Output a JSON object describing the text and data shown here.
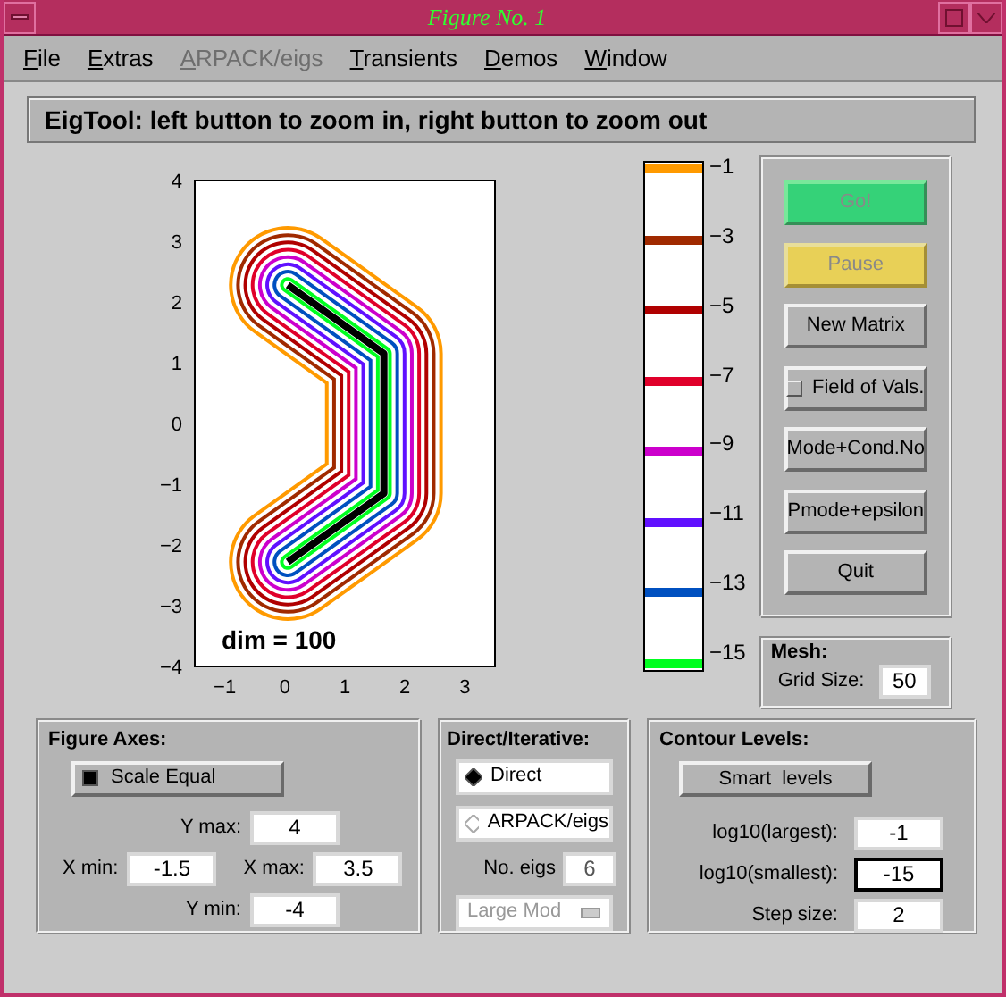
{
  "window": {
    "title": "Figure No. 1"
  },
  "menu": [
    {
      "label": "File",
      "disabled": false
    },
    {
      "label": "Extras",
      "disabled": false
    },
    {
      "label": "ARPACK/eigs",
      "disabled": true
    },
    {
      "label": "Transients",
      "disabled": false
    },
    {
      "label": "Demos",
      "disabled": false
    },
    {
      "label": "Window",
      "disabled": false
    }
  ],
  "message": "EigTool: left button to zoom in, right button to zoom out",
  "plot": {
    "yticks": [
      "4",
      "3",
      "2",
      "1",
      "0",
      "−1",
      "−2",
      "−3",
      "−4"
    ],
    "xticks": [
      "−1",
      "0",
      "1",
      "2",
      "3"
    ],
    "annotation": "dim = 100"
  },
  "colorbar": {
    "levels": [
      {
        "label": "−1",
        "color": "#ff9a00"
      },
      {
        "label": "−3",
        "color": "#a02a00"
      },
      {
        "label": "−5",
        "color": "#b00000"
      },
      {
        "label": "−7",
        "color": "#e0002a"
      },
      {
        "label": "−9",
        "color": "#cc00cc"
      },
      {
        "label": "−11",
        "color": "#6010ff"
      },
      {
        "label": "−13",
        "color": "#0050c0"
      },
      {
        "label": "−15",
        "color": "#00ff20"
      }
    ]
  },
  "buttons": [
    {
      "label": "Go!",
      "kind": "go",
      "disabled": true
    },
    {
      "label": "Pause",
      "kind": "pause",
      "disabled": true
    },
    {
      "label": "New Matrix",
      "kind": "plain",
      "disabled": false
    },
    {
      "label": "Field of Vals.",
      "kind": "toggle",
      "disabled": false,
      "checked": false
    },
    {
      "label": "Mode+Cond.No",
      "kind": "plain",
      "disabled": false
    },
    {
      "label": "Pmode+epsilon",
      "kind": "plain",
      "disabled": false
    },
    {
      "label": "Quit",
      "kind": "plain",
      "disabled": false
    }
  ],
  "mesh": {
    "title": "Mesh:",
    "label": "Grid Size:",
    "value": "50"
  },
  "figure_axes": {
    "title": "Figure Axes:",
    "scale_equal": {
      "label": "Scale Equal",
      "checked": true
    },
    "y_max": {
      "label": "Y max:",
      "value": "4"
    },
    "x_min": {
      "label": "X min:",
      "value": "-1.5"
    },
    "x_max": {
      "label": "X max:",
      "value": "3.5"
    },
    "y_min": {
      "label": "Y min:",
      "value": "-4"
    }
  },
  "direct_iterative": {
    "title": "Direct/Iterative:",
    "options": [
      {
        "label": "Direct",
        "selected": true
      },
      {
        "label": "ARPACK/eigs",
        "selected": false
      }
    ],
    "no_eigs": {
      "label": "No. eigs",
      "value": "6",
      "disabled": true
    },
    "which": {
      "label": "Large Mod",
      "disabled": true
    }
  },
  "contour_levels": {
    "title": "Contour Levels:",
    "button": "Smart  levels",
    "fields": [
      {
        "label": "log10(largest):",
        "value": "-1",
        "focused": false
      },
      {
        "label": "log10(smallest):",
        "value": "-15",
        "focused": true
      },
      {
        "label": "Step size:",
        "value": "2",
        "focused": false
      }
    ]
  }
}
